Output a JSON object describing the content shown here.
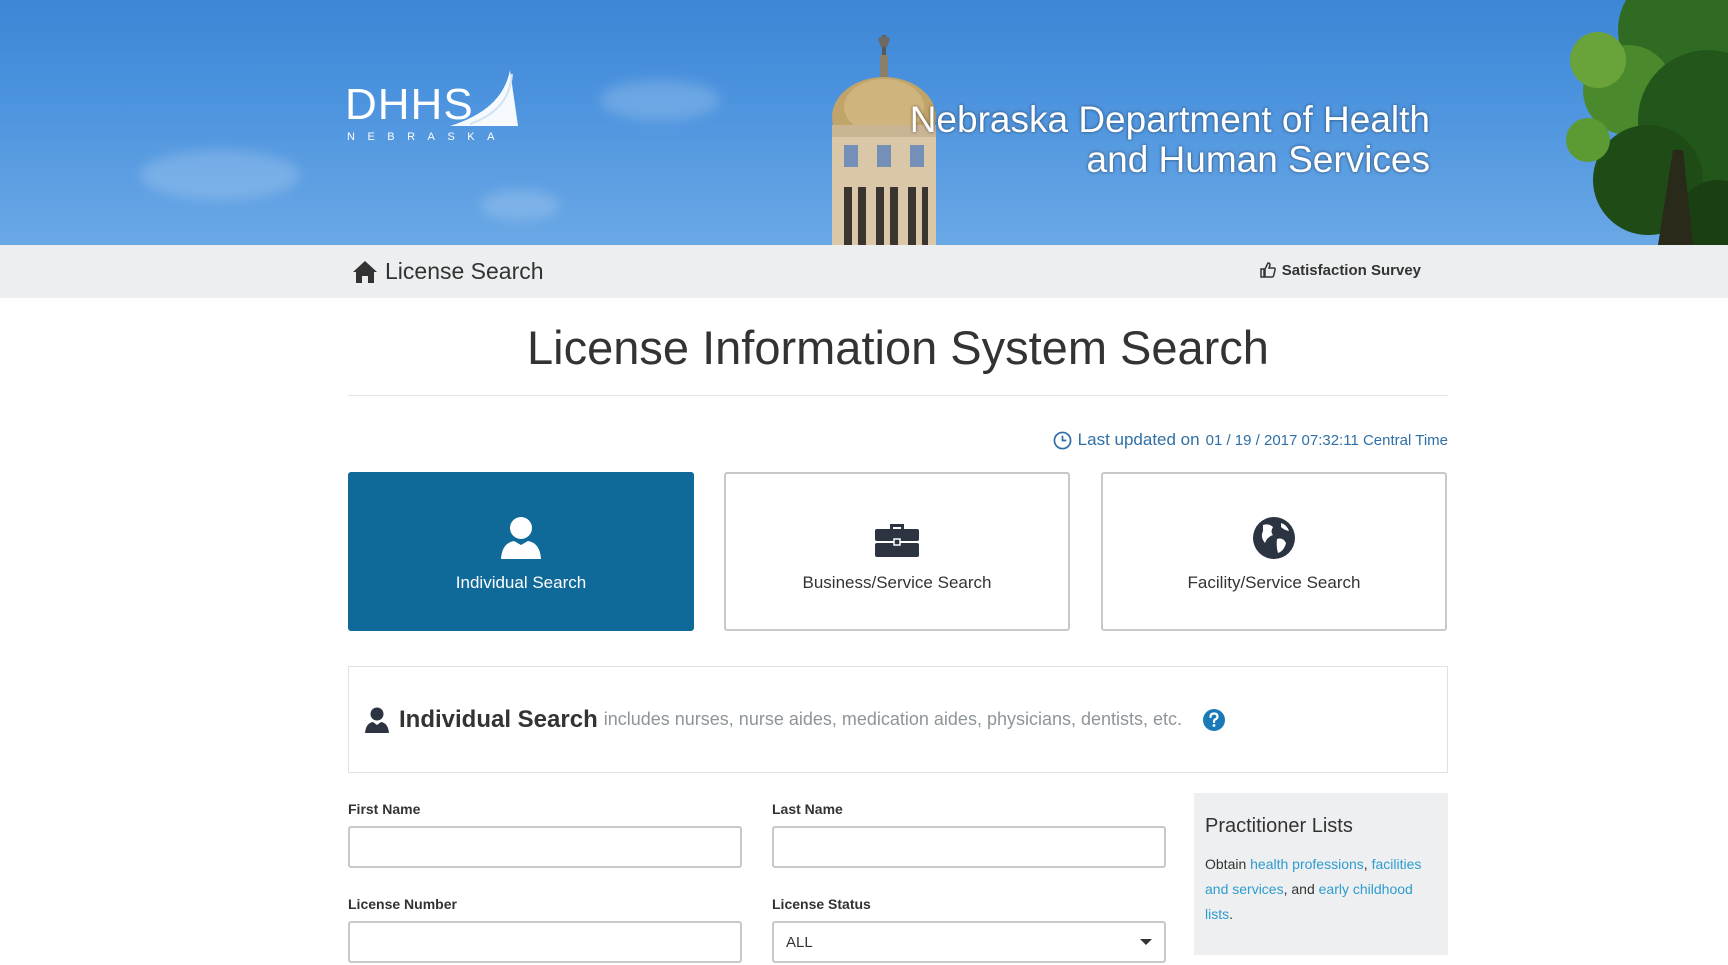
{
  "header": {
    "logo_text": "DHHS",
    "logo_subtext": "NEBRASKA",
    "title_line1": "Nebraska Department of Health",
    "title_line2": "and Human Services"
  },
  "navbar": {
    "home_label": "License Search",
    "home_icon": "home-icon",
    "survey_label": "Satisfaction Survey",
    "survey_icon": "thumbs-up-icon"
  },
  "page": {
    "title": "License Information System Search",
    "updated_label": "Last updated on",
    "updated_value": "01 / 19 / 2017 07:32:11 Central Time"
  },
  "search_types": [
    {
      "label": "Individual Search",
      "icon": "person-icon",
      "active": true
    },
    {
      "label": "Business/Service Search",
      "icon": "briefcase-icon",
      "active": false
    },
    {
      "label": "Facility/Service Search",
      "icon": "globe-icon",
      "active": false
    }
  ],
  "section": {
    "title": "Individual Search",
    "subtitle": "includes nurses, nurse aides, medication aides, physicians, dentists, etc."
  },
  "form": {
    "first_name_label": "First Name",
    "first_name_value": "",
    "last_name_label": "Last Name",
    "last_name_value": "",
    "license_number_label": "License Number",
    "license_number_value": "",
    "license_status_label": "License Status",
    "license_status_value": "ALL"
  },
  "practitioner_lists": {
    "title": "Practitioner Lists",
    "text_obtain": "Obtain",
    "link_health": "health professions",
    "comma1": ",",
    "link_facilities": "facilities and services",
    "text_and": ", and",
    "link_childhood": "early childhood lists",
    "period": "."
  },
  "colors": {
    "primary": "#0f6a9a",
    "link": "#2d9ccf",
    "updated_text": "#2f6fa5",
    "navbar_bg": "#eceeef",
    "help_icon": "#1a7ab8"
  }
}
